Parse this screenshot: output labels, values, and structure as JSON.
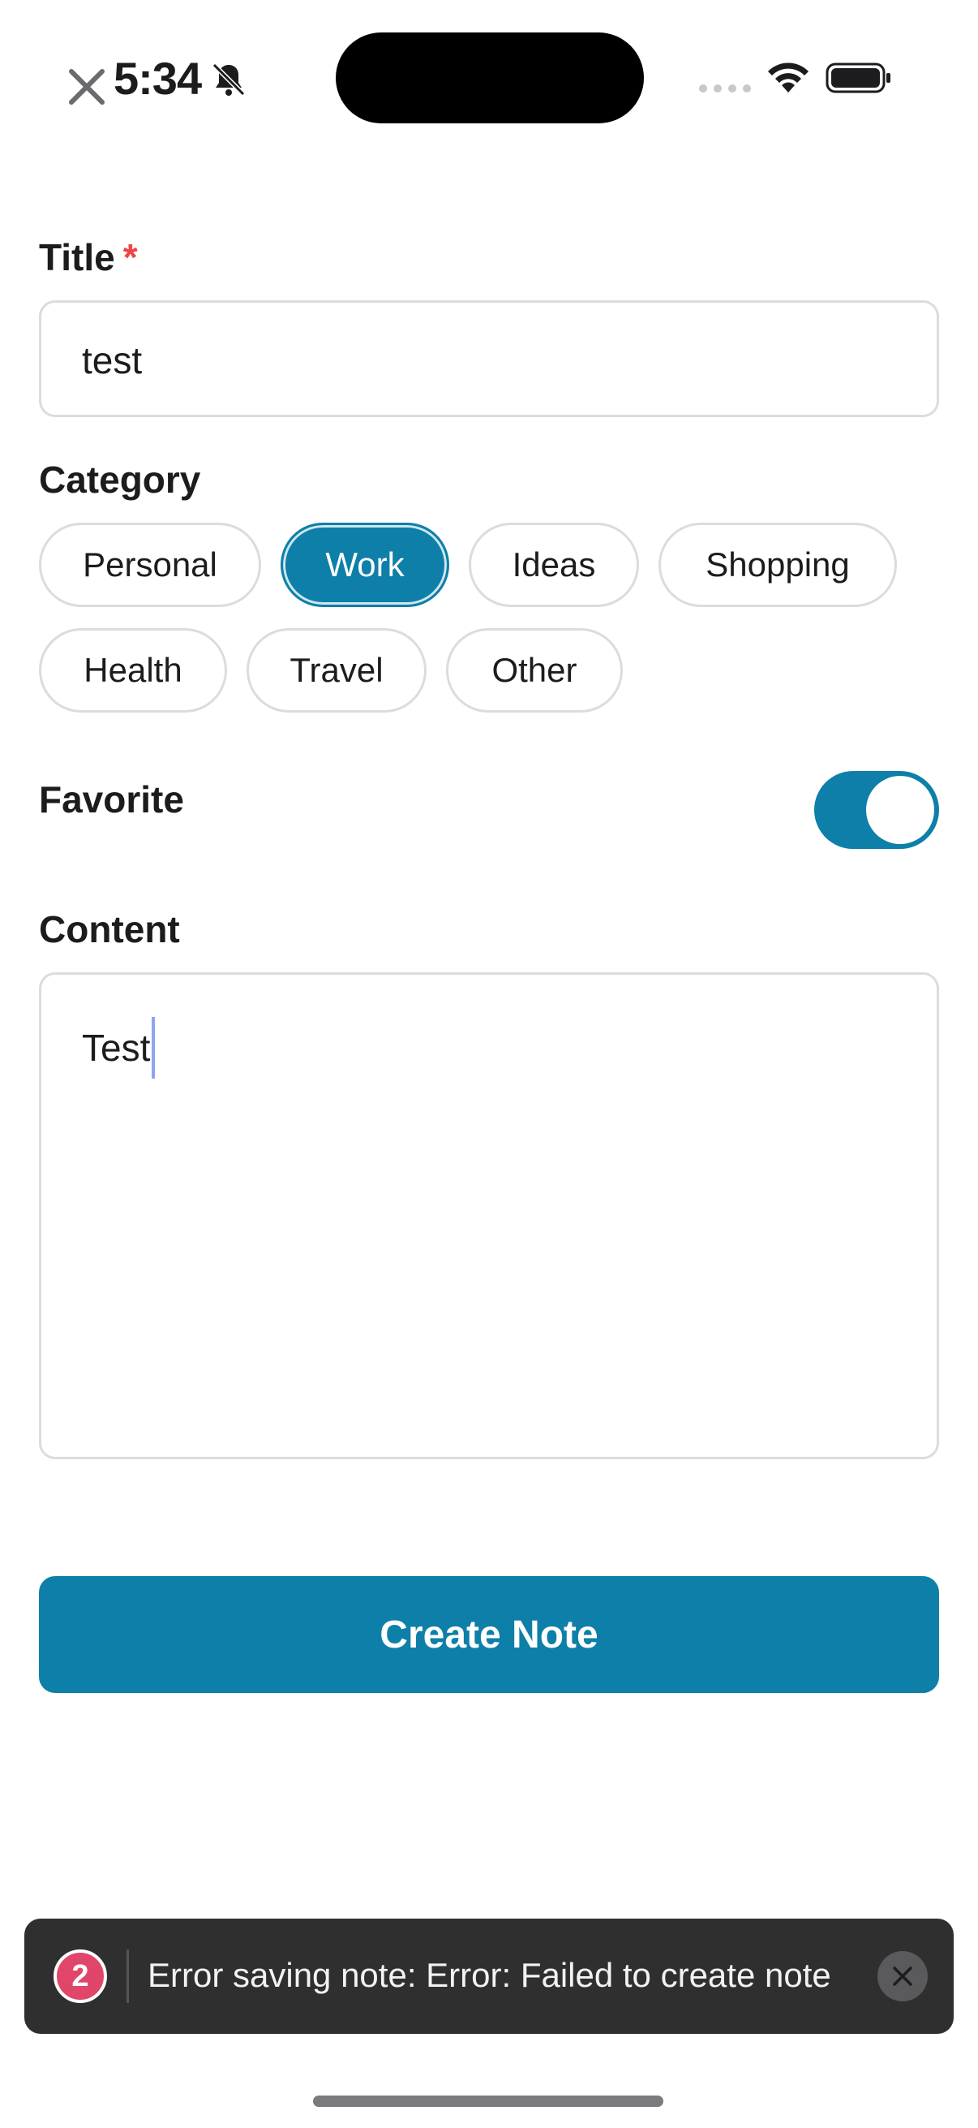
{
  "status_bar": {
    "time": "5:34",
    "icons": [
      "close-icon",
      "bell-off-icon",
      "cellular-icon",
      "wifi-icon",
      "battery-icon"
    ]
  },
  "form": {
    "title": {
      "label": "Title",
      "required_marker": "*",
      "value": "test"
    },
    "category": {
      "label": "Category",
      "options": [
        "Personal",
        "Work",
        "Ideas",
        "Shopping",
        "Health",
        "Travel",
        "Other"
      ],
      "selected": "Work"
    },
    "favorite": {
      "label": "Favorite",
      "enabled": true
    },
    "content": {
      "label": "Content",
      "value": "Test"
    },
    "submit_label": "Create Note"
  },
  "toast": {
    "count": "2",
    "message": "Error saving note: Error: Failed to create note",
    "close_icon": "close-icon"
  },
  "colors": {
    "accent": "#0e7fa8",
    "required": "#ef4444",
    "toast_bg": "#2f2f30",
    "badge": "#e0466a"
  }
}
